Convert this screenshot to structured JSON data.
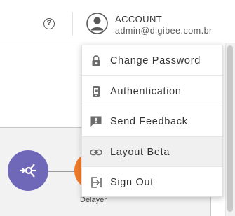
{
  "header": {
    "help_icon": "help-circle-icon",
    "account": {
      "title": "ACCOUNT",
      "email": "admin@digibee.com.br",
      "avatar_icon": "user-avatar-icon"
    }
  },
  "flow": {
    "nodes": [
      {
        "icon": "trigger-icon",
        "label": "",
        "color": "#6f68b8"
      },
      {
        "icon": "delayer-icon",
        "label": "Delayer",
        "color": "#f07a2a"
      }
    ]
  },
  "menu": {
    "items": [
      {
        "label": "Change Password",
        "icon": "lock-icon"
      },
      {
        "label": "Authentication",
        "icon": "phone-icon"
      },
      {
        "label": "Send Feedback",
        "icon": "feedback-icon"
      },
      {
        "label": "Layout Beta",
        "icon": "link-icon",
        "highlighted": true
      },
      {
        "label": "Sign Out",
        "icon": "sign-out-icon"
      }
    ]
  }
}
